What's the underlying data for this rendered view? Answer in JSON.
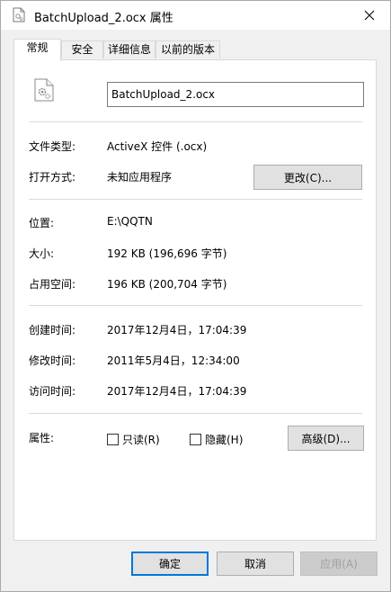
{
  "window": {
    "title": "BatchUpload_2.ocx 属性"
  },
  "tabs": [
    {
      "label": "常规"
    },
    {
      "label": "安全"
    },
    {
      "label": "详细信息"
    },
    {
      "label": "以前的版本"
    }
  ],
  "general": {
    "file_name": "BatchUpload_2.ocx",
    "file_type_label": "文件类型:",
    "file_type_value": "ActiveX 控件 (.ocx)",
    "opens_with_label": "打开方式:",
    "opens_with_value": "未知应用程序",
    "change_button": "更改(C)...",
    "location_label": "位置:",
    "location_value": "E:\\QQTN",
    "size_label": "大小:",
    "size_value": "192 KB (196,696 字节)",
    "size_on_disk_label": "占用空间:",
    "size_on_disk_value": "196 KB (200,704 字节)",
    "created_label": "创建时间:",
    "created_value": "2017年12月4日，17:04:39",
    "modified_label": "修改时间:",
    "modified_value": "2011年5月4日，12:34:00",
    "accessed_label": "访问时间:",
    "accessed_value": "2017年12月4日，17:04:39",
    "attributes_label": "属性:",
    "readonly_label": "只读(R)",
    "hidden_label": "隐藏(H)",
    "advanced_button": "高级(D)..."
  },
  "footer": {
    "ok": "确定",
    "cancel": "取消",
    "apply": "应用(A)"
  }
}
